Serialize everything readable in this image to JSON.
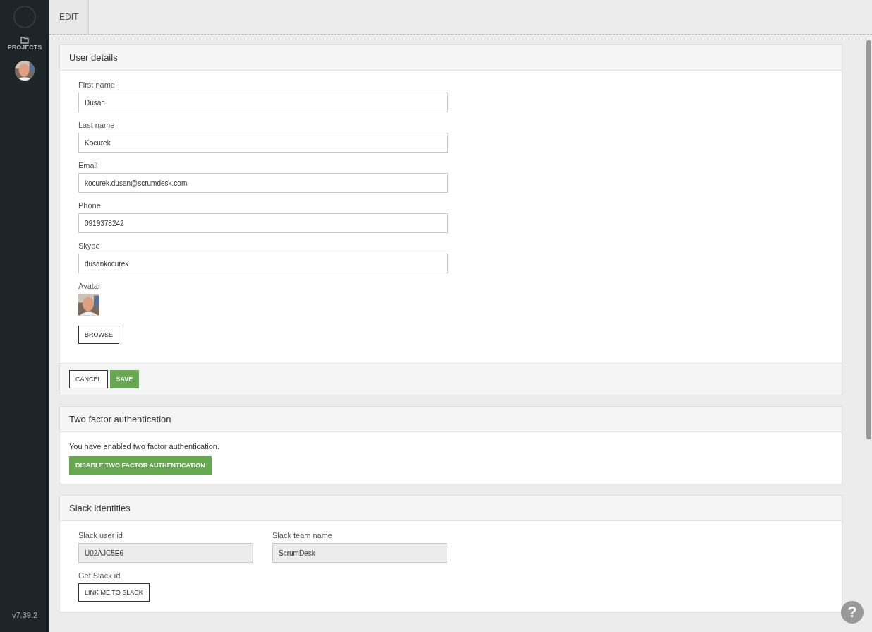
{
  "sidebar": {
    "items": [
      {
        "label": "PROJECTS"
      }
    ],
    "version": "v7.39.2"
  },
  "topbar": {
    "tabs": [
      {
        "label": "EDIT",
        "selected": true
      }
    ]
  },
  "user_details": {
    "title": "User details",
    "fields": [
      {
        "label": "First name",
        "value": "Dusan"
      },
      {
        "label": "Last name",
        "value": "Kocurek"
      },
      {
        "label": "Email",
        "value": "kocurek.dusan@scrumdesk.com"
      },
      {
        "label": "Phone",
        "value": "0919378242"
      },
      {
        "label": "Skype",
        "value": "dusankocurek"
      }
    ],
    "avatar_label": "Avatar",
    "browse": "BROWSE",
    "cancel": "CANCEL",
    "save": "SAVE"
  },
  "two_factor": {
    "title": "Two factor authentication",
    "message": "You have enabled two factor authentication.",
    "button": "DISABLE TWO FACTOR AUTHENTICATION"
  },
  "slack": {
    "title": "Slack identities",
    "fields": [
      {
        "label": "Slack user id",
        "value": "U02AJC5E6",
        "disabled": true
      },
      {
        "label": "Slack team name",
        "value": "ScrumDesk",
        "disabled": true
      }
    ],
    "link_label": "Get Slack id",
    "link_button": "LINK ME TO SLACK"
  },
  "help": "?"
}
